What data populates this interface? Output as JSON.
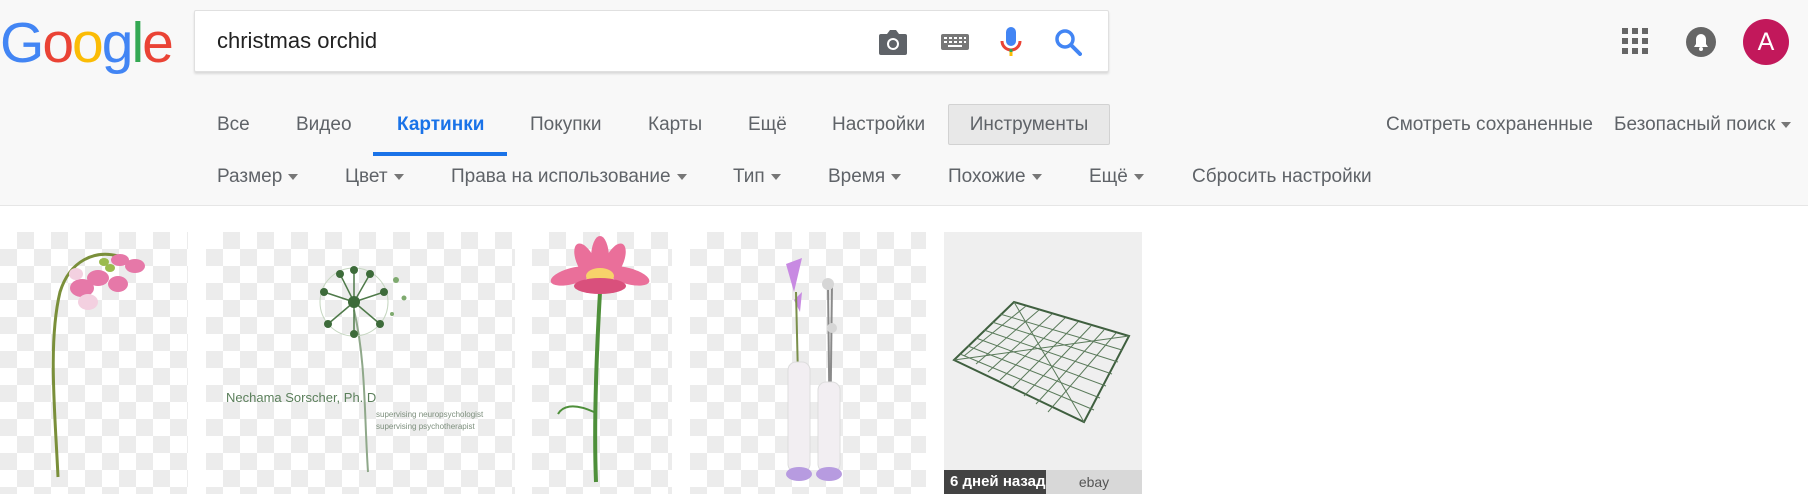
{
  "logo": {
    "letters": [
      "G",
      "o",
      "o",
      "g",
      "l",
      "e"
    ],
    "colors": [
      "#4285f4",
      "#ea4335",
      "#fbbc05",
      "#4285f4",
      "#34a853",
      "#ea4335"
    ]
  },
  "search": {
    "query": "christmas orchid"
  },
  "icons": {
    "camera": "camera-icon",
    "keyboard": "keyboard-icon",
    "mic": "microphone-icon",
    "search": "search-icon",
    "apps": "apps-grid-icon",
    "bell": "notifications-icon"
  },
  "user": {
    "avatar_letter": "A",
    "avatar_color": "#c2185b"
  },
  "tabs": [
    {
      "label": "Все"
    },
    {
      "label": "Видео"
    },
    {
      "label": "Картинки",
      "active": true
    },
    {
      "label": "Покупки"
    },
    {
      "label": "Карты"
    },
    {
      "label": "Ещё"
    },
    {
      "label": "Настройки"
    }
  ],
  "tools_button": "Инструменты",
  "saved_link": "Смотреть сохраненные",
  "safesearch_link": "Безопасный поиск",
  "filters": [
    {
      "label": "Размер"
    },
    {
      "label": "Цвет"
    },
    {
      "label": "Права на использование"
    },
    {
      "label": "Тип"
    },
    {
      "label": "Время"
    },
    {
      "label": "Похожие"
    },
    {
      "label": "Ещё"
    },
    {
      "label": "Сбросить настройки"
    }
  ],
  "results": [
    {
      "subject": "pink orchid stem"
    },
    {
      "subject": "dandelion logo",
      "caption": "Nechama Sorscher, Ph. D",
      "sub1": "supervising neuropsychologist",
      "sub2": "supervising psychotherapist"
    },
    {
      "subject": "pink lotus flower"
    },
    {
      "subject": "calla lilies in vases"
    },
    {
      "subject": "wire grid mesh",
      "badge": "6 дней назад",
      "source": "ebay"
    }
  ],
  "accent_color": "#1a73e8"
}
